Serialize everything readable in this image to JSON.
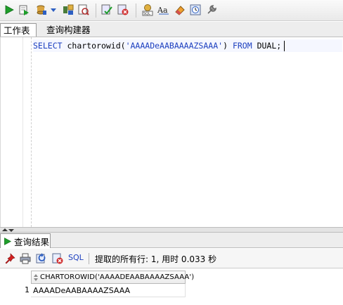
{
  "tabs": [
    {
      "label": "工作表"
    },
    {
      "label": "查询构建器"
    }
  ],
  "editor": {
    "keyword_select": "SELECT",
    "function_name": "chartorowid(",
    "string_literal": "'AAAADeAABAAAAZSAAA'",
    "close_paren": ")",
    "keyword_from": "FROM",
    "table_name": "DUAL;"
  },
  "result_pane": {
    "tab_label": "查询结果",
    "sql_label": "SQL",
    "status_text": "提取的所有行: 1, 用时 0.033 秒"
  },
  "grid": {
    "columns": [
      "CHARTOROWID('AAAADEAABAAAAZSAAA')"
    ],
    "rows": [
      {
        "row_number": "1",
        "values": [
          "AAAADeAABAAAAZSAAA"
        ]
      }
    ]
  },
  "colors": {
    "keyword": "#1c3fbf",
    "run_green": "#1e9e2a"
  }
}
